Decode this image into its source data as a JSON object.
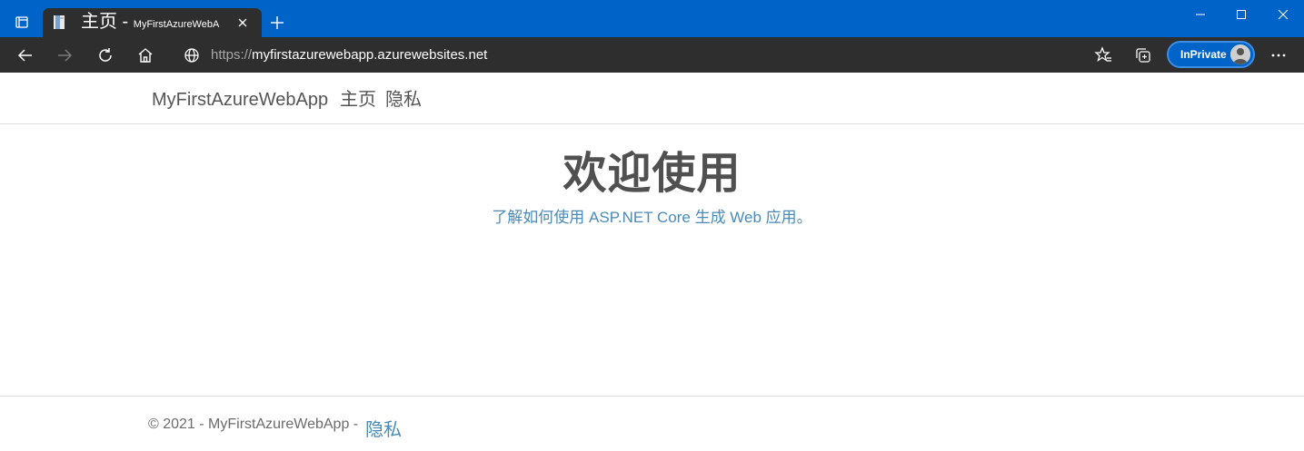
{
  "browser": {
    "tab": {
      "title": "主页 - ",
      "title_small": "MyFirstAzureWebA",
      "favicon": "document-icon"
    },
    "address": {
      "scheme": "https://",
      "host": "myfirstazurewebapp.azurewebsites.net"
    },
    "inprivate_label": "InPrivate",
    "colors": {
      "titlebar": "#0063c8",
      "toolbar": "#2e2e2e",
      "link": "#4a8bb8"
    }
  },
  "site": {
    "brand": "MyFirstAzureWebApp",
    "nav": [
      {
        "label": "主页"
      },
      {
        "label": "隐私"
      }
    ],
    "hero": {
      "title": "欢迎使用",
      "subtitle_prefix": "了解如何",
      "subtitle_link": "使用 ASP.NET Core 生成 Web 应用",
      "subtitle_suffix": "。"
    },
    "footer": {
      "text": "© 2021 - MyFirstAzureWebApp - ",
      "link": "隐私"
    }
  }
}
